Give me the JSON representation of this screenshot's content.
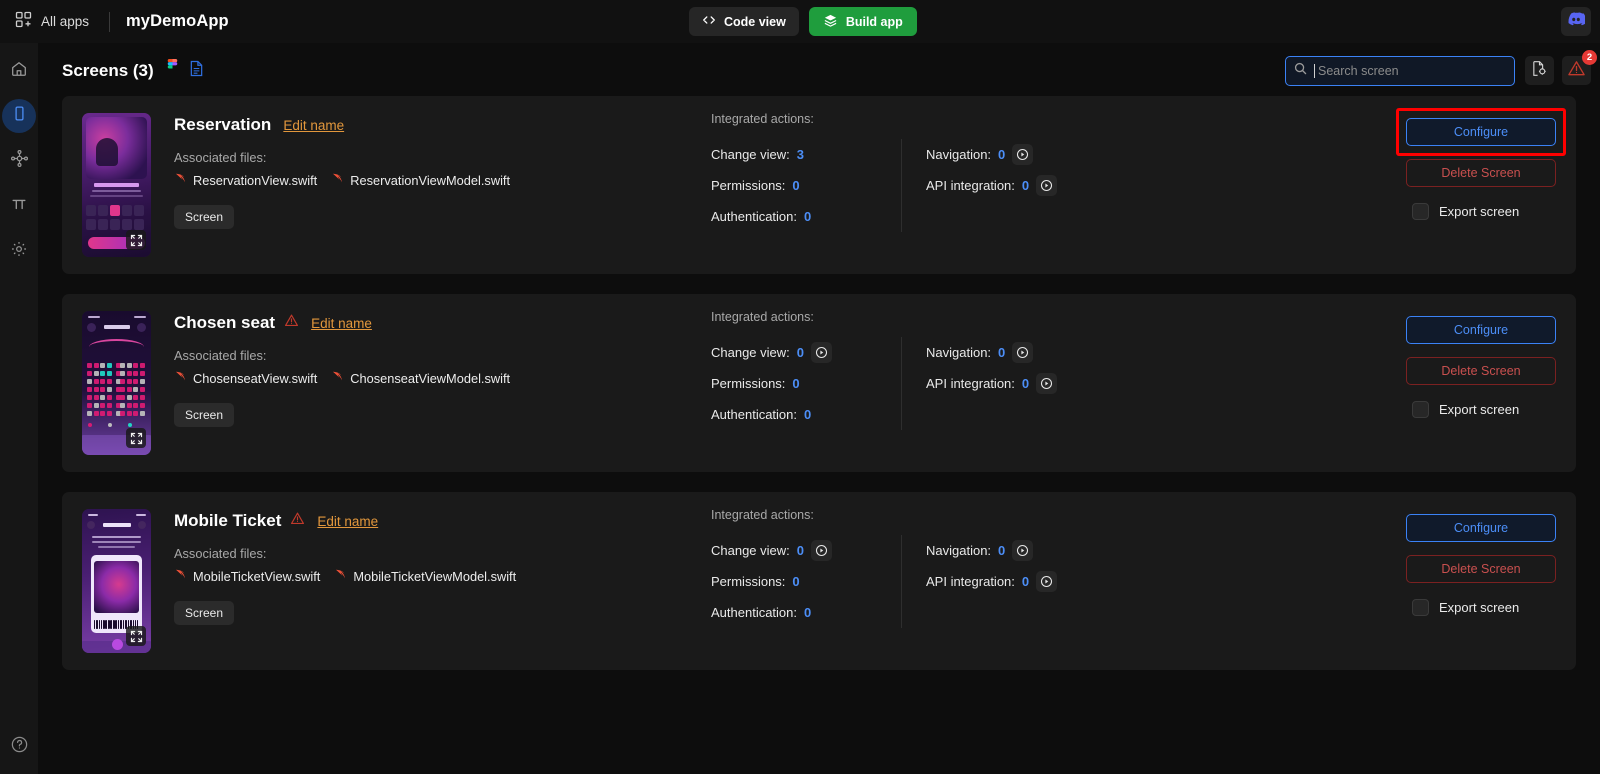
{
  "topbar": {
    "all_apps_label": "All apps",
    "all_apps_icon": "grid-plus-icon",
    "app_name": "myDemoApp",
    "code_view_label": "Code view",
    "code_view_icon": "code-brackets-icon",
    "build_app_label": "Build app",
    "build_app_icon": "stack-layers-icon",
    "discord_icon": "discord-icon",
    "build_color": "#1f9d3d"
  },
  "rail": {
    "items": [
      {
        "name": "home",
        "icon": "home-icon",
        "active": false
      },
      {
        "name": "screens",
        "icon": "mobile-screen-icon",
        "active": true
      },
      {
        "name": "flows",
        "icon": "nodes-flow-icon",
        "active": false
      },
      {
        "name": "typography",
        "icon": "pi-icon",
        "active": false
      },
      {
        "name": "settings",
        "icon": "gear-icon",
        "active": false
      }
    ],
    "help_icon": "question-circle-icon"
  },
  "header": {
    "title": "Screens (3)",
    "figma_icon": "figma-icon",
    "doc_icon": "document-blue-icon",
    "search": {
      "placeholder": "Search screen",
      "value": "",
      "icon": "search-icon",
      "focused": true,
      "border_color": "#3b82f6"
    },
    "file_settings_icon": "file-gear-icon",
    "warning_icon": "warning-triangle-icon",
    "warning_badge": "2",
    "warning_color": "#c0392b",
    "badge_color": "#e53935"
  },
  "labels": {
    "edit_name": "Edit name",
    "associated_files": "Associated files:",
    "screen_tag": "Screen",
    "integrated_actions": "Integrated actions:",
    "change_view": "Change view:",
    "permissions": "Permissions:",
    "authentication": "Authentication:",
    "navigation": "Navigation:",
    "api_integration": "API integration:",
    "configure": "Configure",
    "delete_screen": "Delete Screen",
    "export_screen": "Export screen",
    "swift_icon": "swift-bird-icon",
    "play_icon": "play-circle-icon",
    "expand_icon": "expand-arrows-icon",
    "accent_number_color": "#4c8ef7",
    "edit_link_color": "#e2973c"
  },
  "screens": [
    {
      "name": "Reservation",
      "has_warning": false,
      "files": [
        "ReservationView.swift",
        "ReservationViewModel.swift"
      ],
      "tag": "Screen",
      "thumb_kind": "movie-poster",
      "actions": {
        "change_view": "3",
        "change_view_has_play": false,
        "permissions": "0",
        "authentication": "0",
        "navigation": "0",
        "api_integration": "0"
      },
      "highlighted": true,
      "export_checked": false
    },
    {
      "name": "Chosen seat",
      "has_warning": true,
      "files": [
        "ChosenseatView.swift",
        "ChosenseatViewModel.swift"
      ],
      "tag": "Screen",
      "thumb_kind": "seat-map",
      "actions": {
        "change_view": "0",
        "change_view_has_play": true,
        "permissions": "0",
        "authentication": "0",
        "navigation": "0",
        "api_integration": "0"
      },
      "highlighted": false,
      "export_checked": false
    },
    {
      "name": "Mobile Ticket",
      "has_warning": true,
      "files": [
        "MobileTicketView.swift",
        "MobileTicketViewModel.swift"
      ],
      "tag": "Screen",
      "thumb_kind": "ticket",
      "actions": {
        "change_view": "0",
        "change_view_has_play": true,
        "permissions": "0",
        "authentication": "0",
        "navigation": "0",
        "api_integration": "0"
      },
      "highlighted": false,
      "export_checked": false
    }
  ]
}
